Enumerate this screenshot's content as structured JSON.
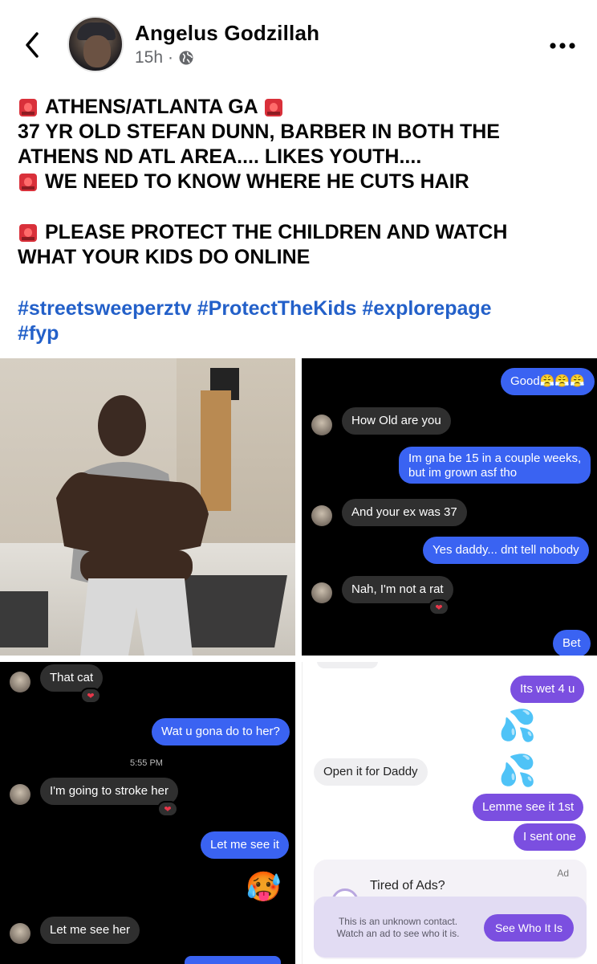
{
  "header": {
    "author": "Angelus Godzillah",
    "time": "15h",
    "separator": "·",
    "privacy_icon": "globe-icon",
    "back_icon": "chevron-left-icon",
    "more_icon": "more-horizontal-icon"
  },
  "post": {
    "siren_icon": "police-light-emoji",
    "lines": {
      "l1": "ATHENS/ATLANTA GA",
      "l2": "37 YR OLD STEFAN DUNN, BARBER IN BOTH THE",
      "l3": "ATHENS ND ATL AREA.... LIKES YOUTH....",
      "l4": "WE NEED TO KNOW WHERE HE CUTS HAIR",
      "l5": "PLEASE PROTECT THE CHILDREN AND WATCH",
      "l6": "WHAT YOUR KIDS DO ONLINE"
    },
    "hashtags": [
      "#streetsweeperztv",
      "#ProtectTheKids",
      "#explorepage",
      "#fyp"
    ]
  },
  "chat2": {
    "m1": "Good😤😤😤",
    "m2": "How Old are you",
    "m3a": "Im gna be 15 in a couple weeks,",
    "m3b": "but im grown asf tho",
    "m4": "And your ex was 37",
    "m5": "Yes daddy... dnt tell nobody",
    "m6": "Nah, I'm not a rat",
    "m7": "Bet",
    "reaction": "❤"
  },
  "chat3": {
    "m1": "That cat",
    "m2": "Wat u gona do to her?",
    "timestamp": "5:55 PM",
    "m3": "I'm going to stroke her",
    "m4": "Let me see it",
    "emoji": "🥵",
    "m5": "Let me see her",
    "reaction": "❤"
  },
  "chat4": {
    "m1": "Its wet 4 u",
    "emoji": "💦 💦",
    "m2": "Open it for Daddy",
    "m3": "Lemme see it 1st",
    "m4": "I sent one",
    "ad": {
      "label": "Ad",
      "title": "Tired of Ads?",
      "text": "This is an unknown contact. Watch an ad to see who it is.",
      "button": "See Who It Is"
    }
  },
  "colors": {
    "hashtag": "#2360c9",
    "blue_bubble": "#3a63f2",
    "purple_bubble": "#7b4fe0",
    "dark_bubble": "#2f2f2f"
  }
}
